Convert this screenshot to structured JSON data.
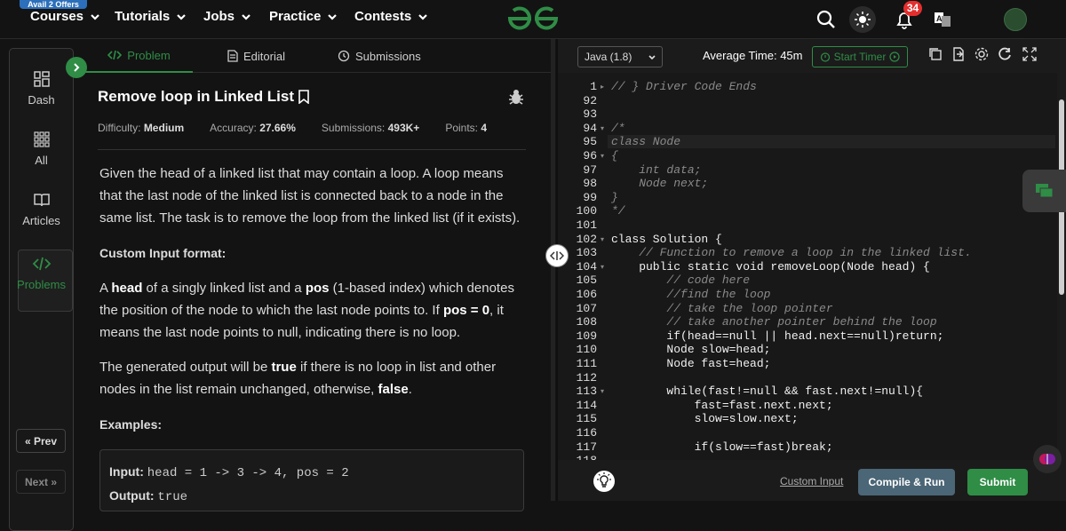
{
  "nav": {
    "offer": "Avail 2 Offers",
    "items": [
      "Courses",
      "Tutorials",
      "Jobs",
      "Practice",
      "Contests"
    ],
    "notification_count": "34",
    "brand_color": "#2f8d46"
  },
  "sidebar": {
    "items": [
      "Dash",
      "All",
      "Articles",
      "Problems"
    ],
    "prev": "« Prev",
    "next": "Next »"
  },
  "tabs": [
    "Problem",
    "Editorial",
    "Submissions"
  ],
  "problem": {
    "title": "Remove loop in Linked List",
    "difficulty_label": "Difficulty:",
    "difficulty": "Medium",
    "accuracy_label": "Accuracy:",
    "accuracy": "27.66%",
    "submissions_label": "Submissions:",
    "submissions": "493K+",
    "points_label": "Points:",
    "points": "4",
    "description": "Given the head of a linked list that may contain a loop.  A loop means that the last node of the linked list is connected back to a node in the same list. The task is to remove the loop from the linked list (if it exists).",
    "custom_input_heading": "Custom Input format:",
    "input_format": {
      "p1": "A ",
      "b1": "head",
      "p2": " of a singly linked list and a ",
      "b2": "pos",
      "p3": " (1-based index) which denotes the position of the node to which the last node points to. If ",
      "b3": "pos = 0",
      "p4": ", it means the last node points to null, indicating there is no loop."
    },
    "output_desc": {
      "p1": "The generated output will be ",
      "b1": "true",
      "p2": " if there is no loop in list and other nodes in the list remain unchanged, otherwise, ",
      "b2": "false",
      "p3": "."
    },
    "examples_heading": "Examples:",
    "example": {
      "input_label": "Input:",
      "input": "head = 1 -> 3 -> 4, pos = 2",
      "output_label": "Output:",
      "output": "true"
    }
  },
  "editor": {
    "language": "Java (1.8)",
    "avg_time": "Average Time: 45m",
    "start_timer": "Start Timer",
    "lines": [
      {
        "n": "1",
        "text": "// } Driver Code Ends",
        "cls": "cm"
      },
      {
        "n": "92",
        "text": ""
      },
      {
        "n": "93",
        "text": ""
      },
      {
        "n": "94",
        "text": "/*",
        "cls": "cm"
      },
      {
        "n": "95",
        "text": "class Node",
        "cls": "cm"
      },
      {
        "n": "96",
        "text": "{",
        "cls": "cm"
      },
      {
        "n": "97",
        "text": "    int data;",
        "cls": "cm"
      },
      {
        "n": "98",
        "text": "    Node next;",
        "cls": "cm"
      },
      {
        "n": "99",
        "text": "}",
        "cls": "cm"
      },
      {
        "n": "100",
        "text": "*/",
        "cls": "cm"
      },
      {
        "n": "101",
        "text": ""
      },
      {
        "n": "102",
        "text": "class Solution {"
      },
      {
        "n": "103",
        "text": "    // Function to remove a loop in the linked list.",
        "cls": "cm"
      },
      {
        "n": "104",
        "text": "    public static void removeLoop(Node head) {"
      },
      {
        "n": "105",
        "text": "        // code here",
        "cls": "cm"
      },
      {
        "n": "106",
        "text": "        //find the loop",
        "cls": "cm"
      },
      {
        "n": "107",
        "text": "        // take the loop pointer",
        "cls": "cm"
      },
      {
        "n": "108",
        "text": "        // take another pointer behind the loop",
        "cls": "cm"
      },
      {
        "n": "109",
        "text": "        if(head==null || head.next==null)return;"
      },
      {
        "n": "110",
        "text": "        Node slow=head;"
      },
      {
        "n": "111",
        "text": "        Node fast=head;"
      },
      {
        "n": "112",
        "text": ""
      },
      {
        "n": "113",
        "text": "        while(fast!=null && fast.next!=null){"
      },
      {
        "n": "114",
        "text": "            fast=fast.next.next;"
      },
      {
        "n": "115",
        "text": "            slow=slow.next;"
      },
      {
        "n": "116",
        "text": ""
      },
      {
        "n": "117",
        "text": "            if(slow==fast)break;"
      },
      {
        "n": "118",
        "text": ""
      }
    ],
    "custom_input": "Custom Input",
    "compile": "Compile & Run",
    "submit": "Submit"
  }
}
